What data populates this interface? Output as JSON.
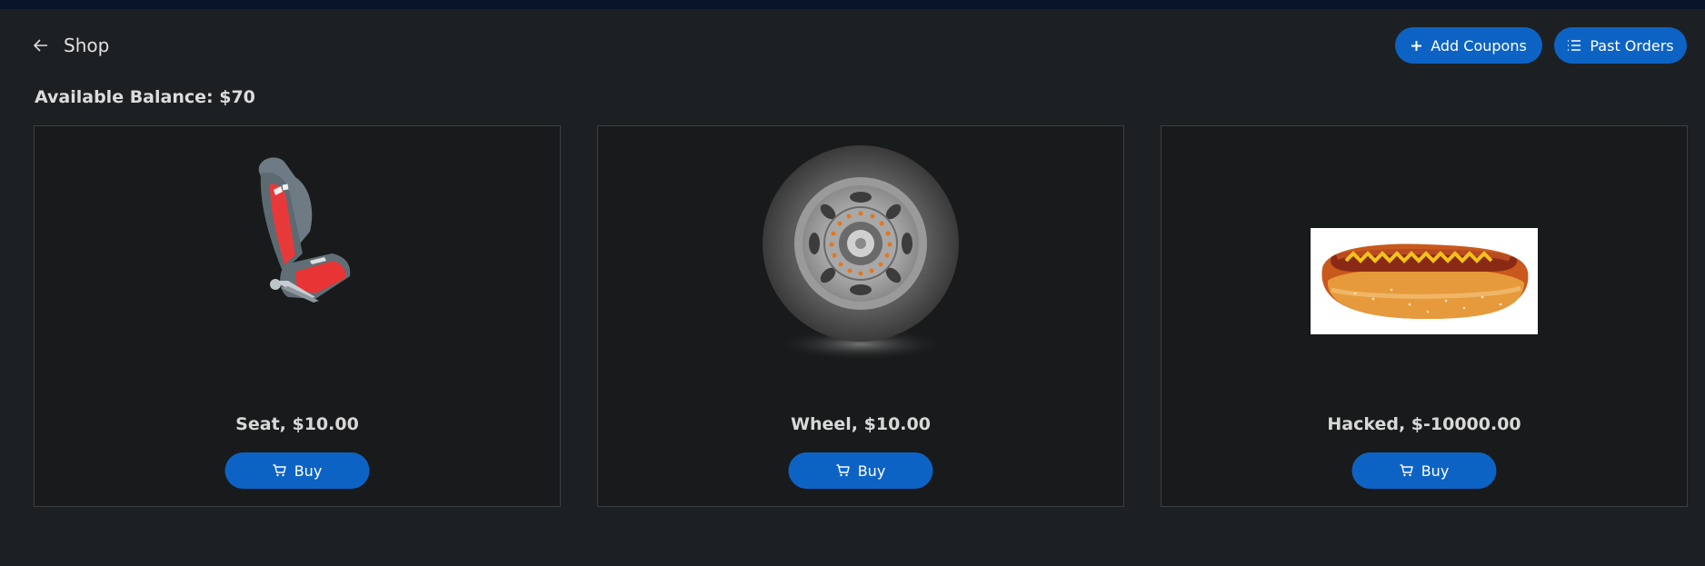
{
  "header": {
    "title": "Shop"
  },
  "actions": {
    "add_coupons": "Add Coupons",
    "past_orders": "Past Orders"
  },
  "balance": {
    "text": "Available Balance: $70"
  },
  "products": [
    {
      "label": "Seat, $10.00",
      "buy": "Buy",
      "image": "seat"
    },
    {
      "label": "Wheel, $10.00",
      "buy": "Buy",
      "image": "wheel"
    },
    {
      "label": "Hacked, $-10000.00",
      "buy": "Buy",
      "image": "hotdog"
    }
  ],
  "colors": {
    "background": "#1d2023",
    "card": "#181a1b",
    "accent": "#0d63c4",
    "topbar": "#07142a"
  }
}
